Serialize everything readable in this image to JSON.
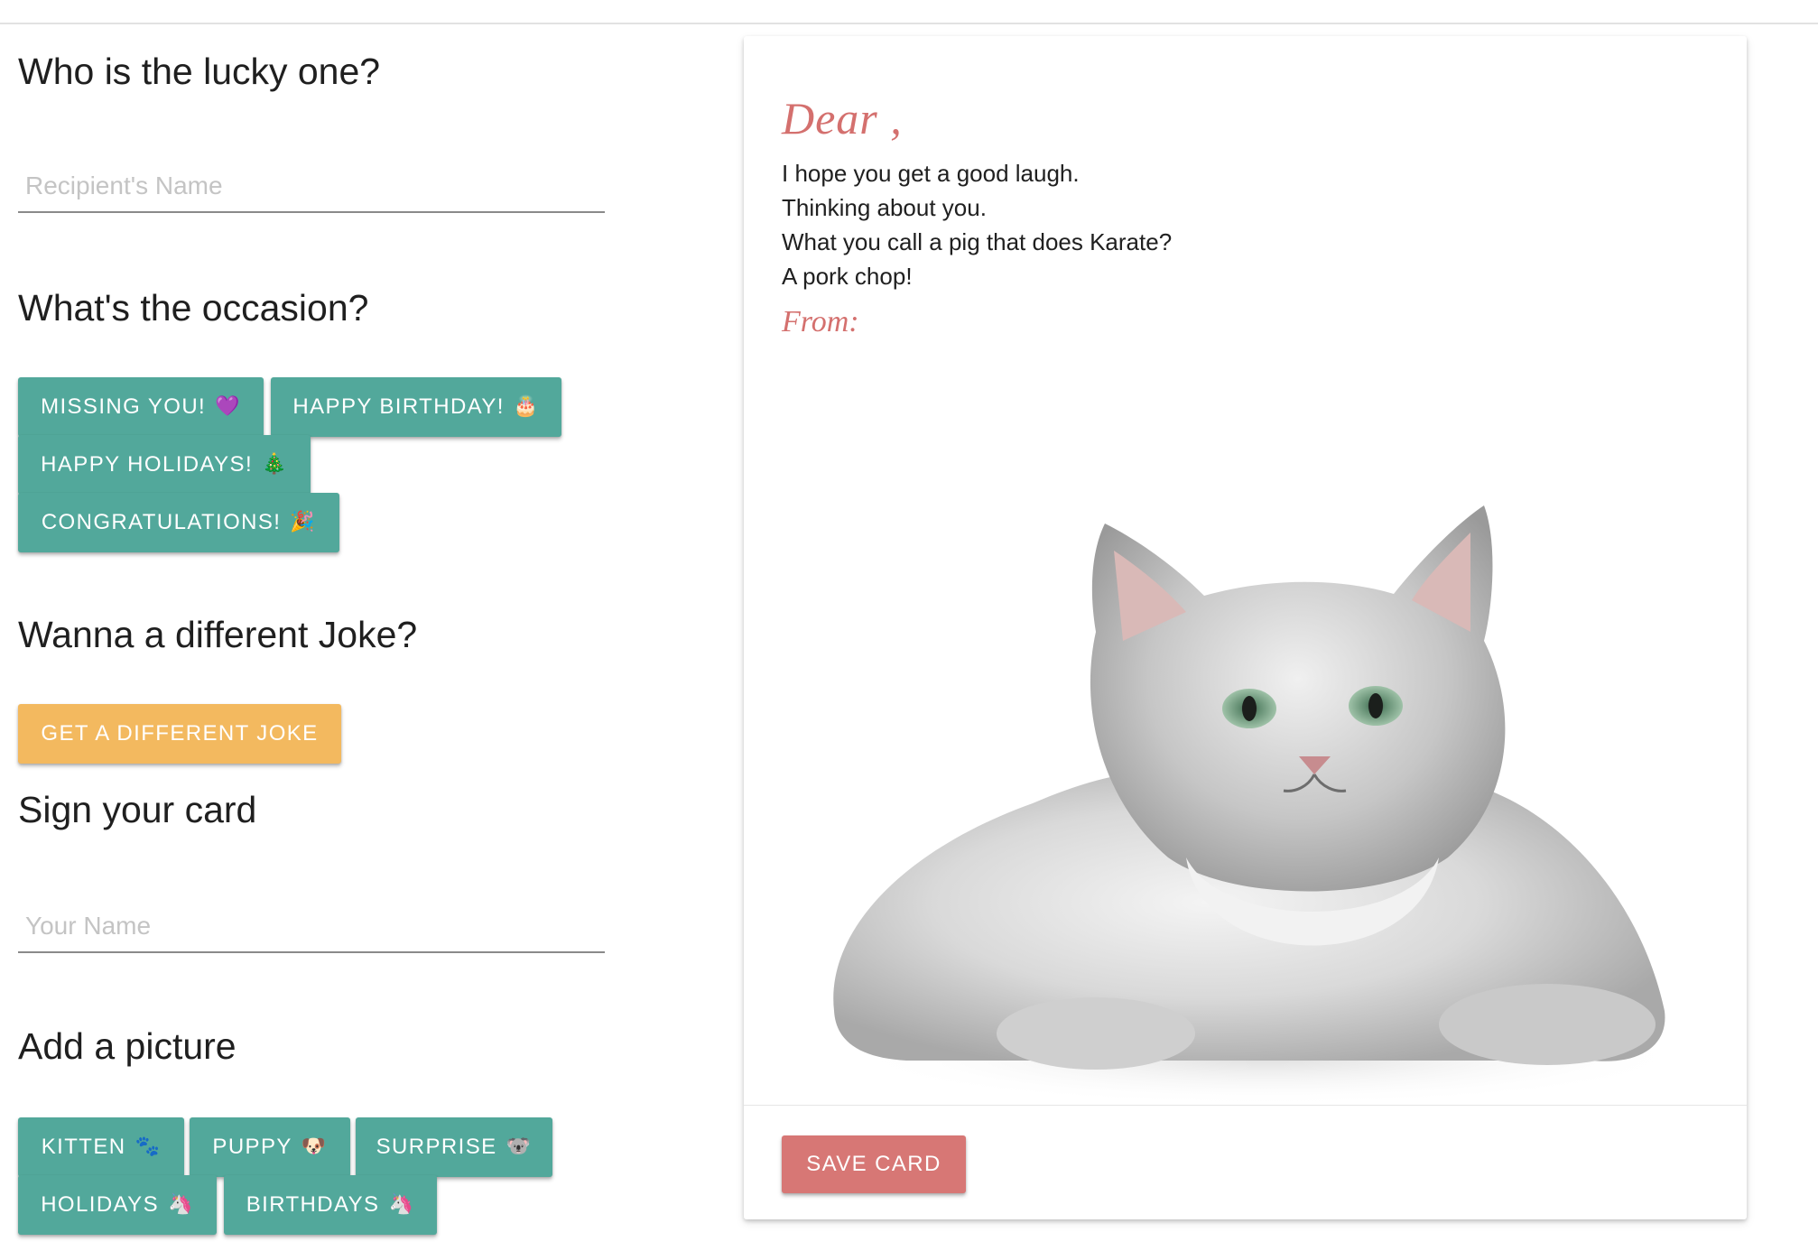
{
  "form": {
    "recipient_heading": "Who is the lucky one?",
    "recipient_placeholder": "Recipient's Name",
    "occasion_heading": "What's the occasion?",
    "occasions": [
      {
        "label": "Missing you!",
        "emoji": "💜",
        "icon": "purple-heart-icon"
      },
      {
        "label": "Happy Birthday!",
        "emoji": "🎂",
        "icon": "birthday-cake-icon"
      },
      {
        "label": "Happy Holidays!",
        "emoji": "🎄",
        "icon": "christmas-tree-icon"
      },
      {
        "label": "Congratulations!",
        "emoji": "🎉",
        "icon": "party-popper-icon"
      }
    ],
    "joke_heading": "Wanna a different Joke?",
    "joke_button": "Get a different joke",
    "sign_heading": "Sign your card",
    "sign_placeholder": "Your Name",
    "picture_heading": "Add a picture",
    "pictures": [
      {
        "label": "Kitten",
        "emoji": "🐾",
        "icon": "paw-prints-icon"
      },
      {
        "label": "Puppy",
        "emoji": "🐶",
        "icon": "dog-face-icon"
      },
      {
        "label": "Surprise",
        "emoji": "🐨",
        "icon": "koala-icon"
      },
      {
        "label": "Holidays",
        "emoji": "🦄",
        "icon": "unicorn-icon"
      },
      {
        "label": "Birthdays",
        "emoji": "🦄",
        "icon": "unicorn-icon"
      }
    ]
  },
  "card": {
    "dear": "Dear ,",
    "joke_lines": [
      "I hope you get a good laugh.",
      "Thinking about you.",
      "What you call a pig that does Karate?",
      "A pork chop!"
    ],
    "from": "From:",
    "save_button": "Save card"
  },
  "colors": {
    "teal": "#52a89b",
    "gold": "#f3b95f",
    "coral": "#d77775",
    "card_script": "#d4706e"
  }
}
